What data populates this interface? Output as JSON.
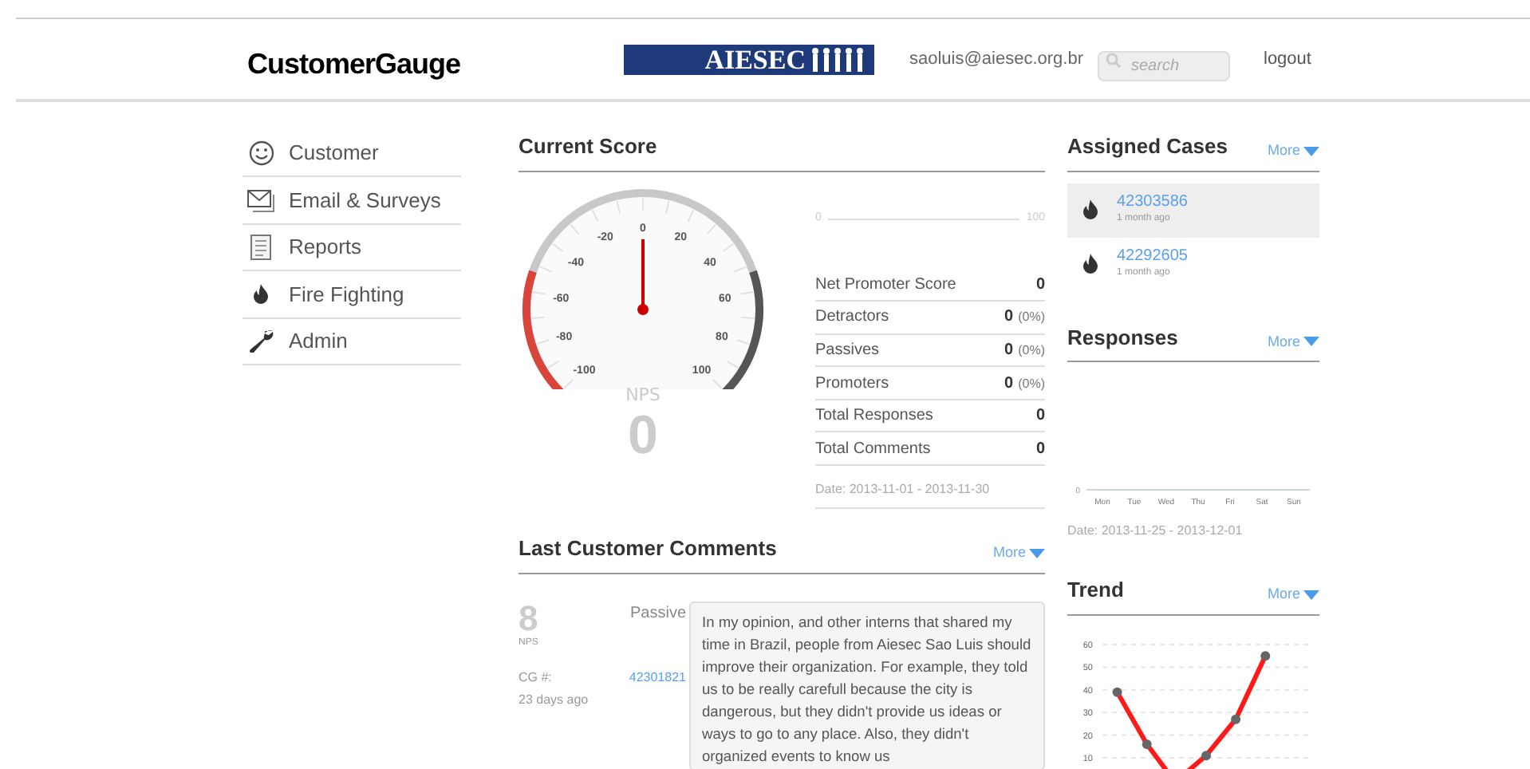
{
  "header": {
    "logo": "CustomerGauge",
    "org_banner": "AIESEC",
    "email": "saoluis@aiesec.org.br",
    "search": {
      "placeholder": "search"
    },
    "logout": "logout"
  },
  "sidebar": {
    "items": [
      {
        "label": "Customer"
      },
      {
        "label": "Email & Surveys"
      },
      {
        "label": "Reports"
      },
      {
        "label": "Fire Fighting"
      },
      {
        "label": "Admin"
      }
    ]
  },
  "current_score": {
    "title": "Current Score",
    "gauge": {
      "tick_labels": [
        "-100",
        "-80",
        "-60",
        "-40",
        "-20",
        "0",
        "20",
        "40",
        "60",
        "80",
        "100"
      ],
      "caption": "NPS",
      "value": "0"
    },
    "range": {
      "min_label": "0",
      "max_label": "100"
    },
    "stats": [
      {
        "label": "Net Promoter Score",
        "value": "0"
      },
      {
        "label": "Detractors",
        "value": "0",
        "percent": "(0%)"
      },
      {
        "label": "Passives",
        "value": "0",
        "percent": "(0%)"
      },
      {
        "label": "Promoters",
        "value": "0",
        "percent": "(0%)"
      },
      {
        "label": "Total Responses",
        "value": "0"
      },
      {
        "label": "Total Comments",
        "value": "0"
      }
    ],
    "date": "Date: 2013-11-01 - 2013-11-30"
  },
  "comments": {
    "title": "Last Customer Comments",
    "more": "More",
    "items": [
      {
        "score": "8",
        "score_label": "NPS",
        "category": "Passive",
        "cg_label": "CG #:",
        "cg_number": "42301821",
        "age": "23 days ago",
        "text": "In my opinion, and other interns that shared my time in Brazil, people from Aiesec Sao Luis should improve their organization. For example, they told us to be really carefull because the city is dangerous, but they didn't provide us ideas or ways to go to any place. Also, they didn't organized events to know us"
      }
    ]
  },
  "assigned_cases": {
    "title": "Assigned Cases",
    "more": "More",
    "items": [
      {
        "number": "42303586",
        "age": "1 month ago",
        "selected": true
      },
      {
        "number": "42292605",
        "age": "1 month ago",
        "selected": false
      }
    ]
  },
  "responses": {
    "title": "Responses",
    "more": "More",
    "date": "Date: 2013-11-25 - 2013-12-01",
    "chart": {
      "y_label": "0",
      "day_labels": [
        "Mon",
        "Tue",
        "Wed",
        "Thu",
        "Fri",
        "Sat",
        "Sun"
      ]
    }
  },
  "trend": {
    "title": "Trend",
    "more": "More",
    "chart_data": {
      "type": "line",
      "categories": [
        null,
        null,
        null,
        null,
        null,
        null,
        null
      ],
      "series": [
        {
          "color": "#ff1a1a",
          "marker": "circle",
          "values": [
            39,
            16,
            null,
            11,
            27,
            55,
            null
          ]
        }
      ],
      "ylim": [
        10,
        60
      ],
      "yticks": [
        10,
        20,
        30,
        40,
        50,
        60
      ],
      "grid": true
    }
  }
}
